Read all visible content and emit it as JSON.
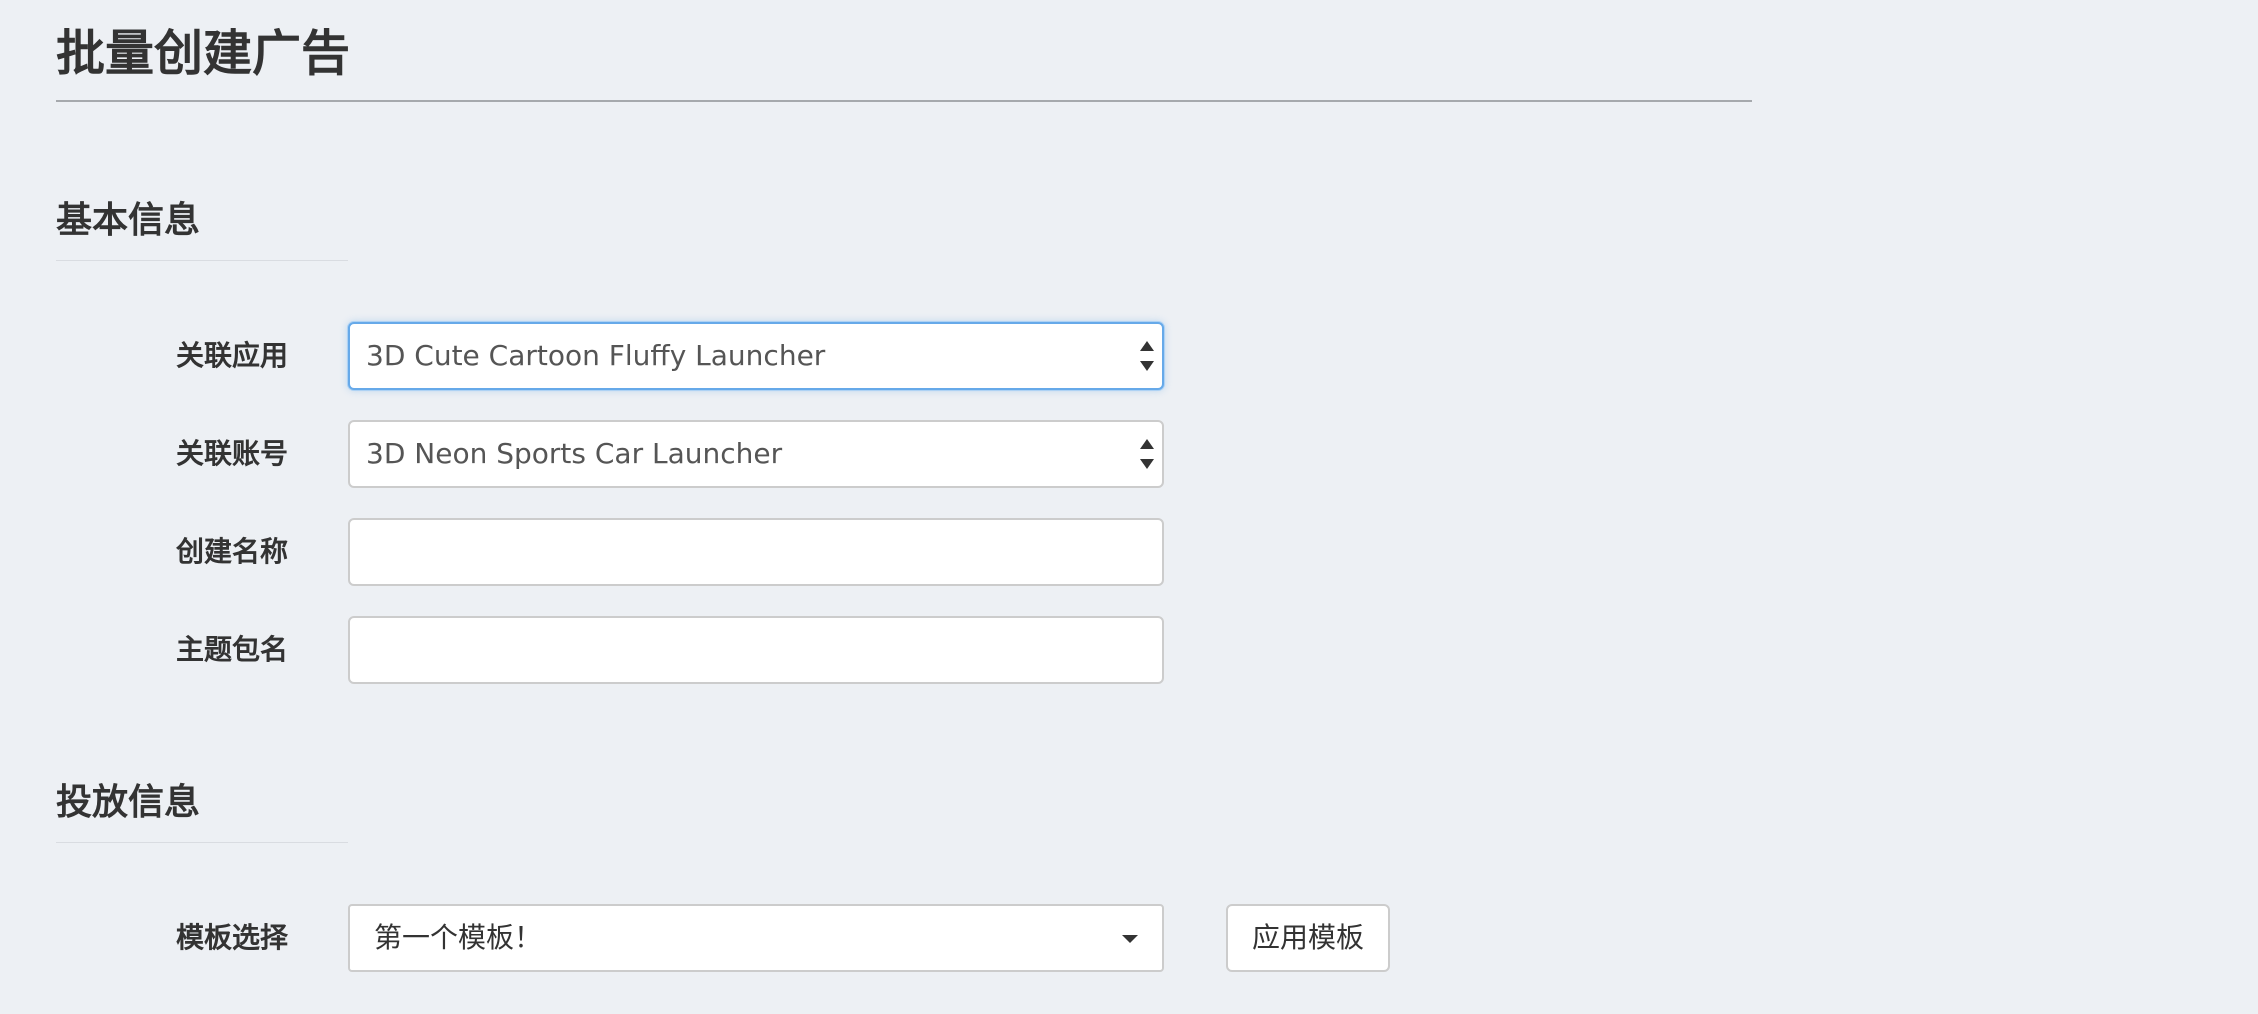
{
  "page": {
    "title": "批量创建广告"
  },
  "basic_info": {
    "heading": "基本信息",
    "fields": {
      "app": {
        "label": "关联应用",
        "value": "3D Cute Cartoon Fluffy Launcher"
      },
      "account": {
        "label": "关联账号",
        "value": "3D Neon Sports Car Launcher"
      },
      "create_name": {
        "label": "创建名称",
        "value": ""
      },
      "theme_package": {
        "label": "主题包名",
        "value": ""
      }
    }
  },
  "delivery_info": {
    "heading": "投放信息",
    "template": {
      "label": "模板选择",
      "value": "第一个模板！",
      "apply_label": "应用模板"
    }
  },
  "colors": {
    "background": "#edf0f4",
    "focus_border": "#66a9e9",
    "text": "#333333"
  }
}
